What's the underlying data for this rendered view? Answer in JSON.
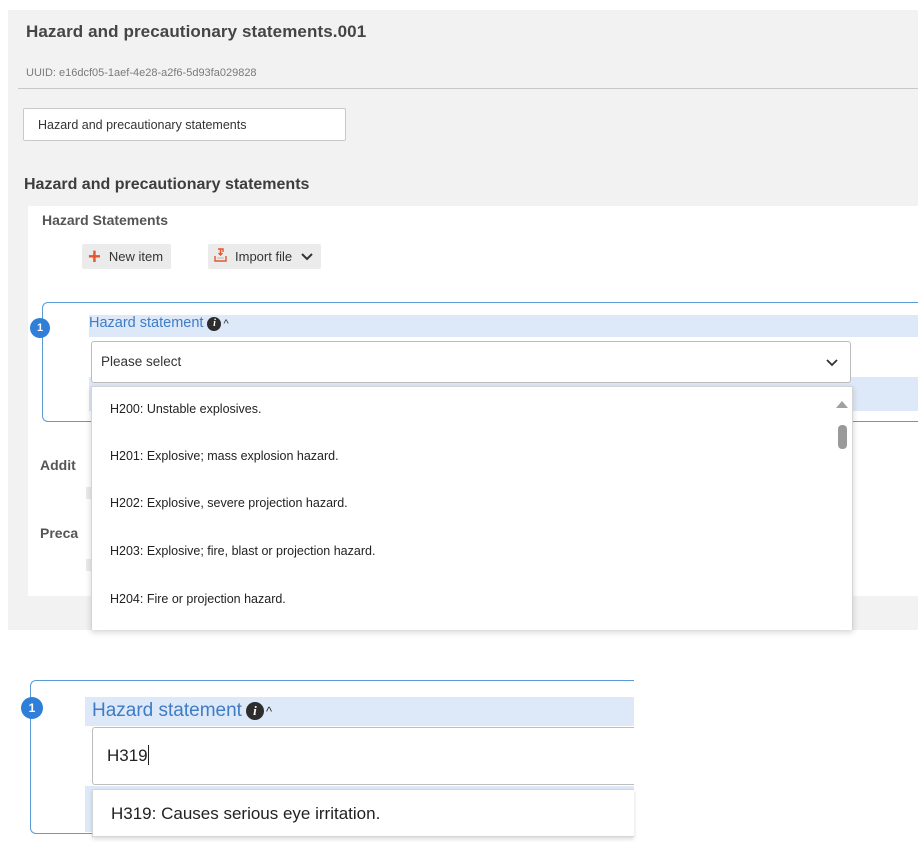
{
  "header": {
    "title": "Hazard and precautionary statements.001",
    "uuid": "UUID: e16dcf05-1aef-4e28-a2f6-5d93fa029828"
  },
  "doc_button_label": "Hazard and precautionary statements",
  "section_title": "Hazard and precautionary statements",
  "hazard_statements": {
    "title": "Hazard Statements",
    "new_item_label": "New item",
    "import_file_label": "Import file"
  },
  "item": {
    "index": "1",
    "label": "Hazard statement",
    "select_value": "Please select"
  },
  "truncated_labels": {
    "additional": "Addit",
    "precautionary": "Preca"
  },
  "dropdown_options": [
    "H200: Unstable explosives.",
    "H201: Explosive; mass explosion hazard.",
    "H202: Explosive, severe projection hazard.",
    "H203: Explosive; fire, blast or projection hazard.",
    "H204: Fire or projection hazard."
  ],
  "search_example": {
    "index": "1",
    "label": "Hazard statement",
    "input_value": "H319",
    "suggestion": "H319: Causes serious eye irritation."
  },
  "colors": {
    "accent_blue": "#2f7fd8",
    "label_blue": "#3f7cc3",
    "highlight": "#dde9f8",
    "icon_orange": "#e4572e"
  },
  "icons": {
    "new_item": "plus-icon",
    "import_file": "import-file-icon",
    "import_menu": "chevron-down-icon",
    "info": "info-icon",
    "collapse": "caret-up-icon",
    "select_open": "chevron-down-icon"
  }
}
